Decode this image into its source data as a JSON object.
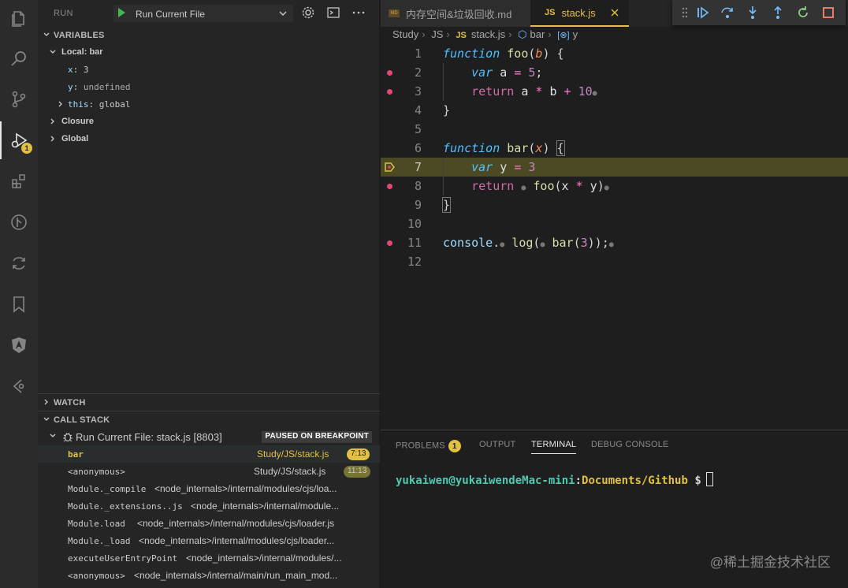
{
  "activity_bar": {
    "items": [
      "explorer-icon",
      "search-icon",
      "source-control-icon",
      "run-debug-icon",
      "extensions-icon",
      "git-graph-icon",
      "remote-sync-icon",
      "bookmarks-icon",
      "angular-icon",
      "gitlens-icon"
    ],
    "debug_badge": "1"
  },
  "run": {
    "label": "RUN",
    "config": "Run Current File"
  },
  "variables": {
    "header": "VARIABLES",
    "local_label": "Local: bar",
    "items": [
      {
        "name": "x",
        "value": "3"
      },
      {
        "name": "y",
        "value": "undefined"
      },
      {
        "name": "this",
        "value": "global"
      }
    ],
    "closure": "Closure",
    "global": "Global"
  },
  "watch": {
    "header": "WATCH"
  },
  "call_stack": {
    "header": "CALL STACK",
    "session": "Run Current File: stack.js [8803]",
    "status": "PAUSED ON BREAKPOINT",
    "frames": [
      {
        "fn": "bar",
        "path": "Study/JS/stack.js",
        "pos": "7:13"
      },
      {
        "fn": "<anonymous>",
        "path": "Study/JS/stack.js",
        "pos": "11:13"
      },
      {
        "fn": "Module._compile",
        "path": "<node_internals>/internal/modules/cjs/loa..."
      },
      {
        "fn": "Module._extensions..js",
        "path": "<node_internals>/internal/module..."
      },
      {
        "fn": "Module.load",
        "path": "<node_internals>/internal/modules/cjs/loader.js"
      },
      {
        "fn": "Module._load",
        "path": "<node_internals>/internal/modules/cjs/loader..."
      },
      {
        "fn": "executeUserEntryPoint",
        "path": "<node_internals>/internal/modules/..."
      },
      {
        "fn": "<anonymous>",
        "path": "<node_internals>/internal/main/run_main_mod..."
      }
    ]
  },
  "tabs": [
    {
      "label": "内存空间&垃圾回收.md",
      "active": false
    },
    {
      "label": "stack.js",
      "active": true
    }
  ],
  "breadcrumb": [
    "Study",
    "JS",
    "stack.js",
    "bar",
    "y"
  ],
  "breadcrumb_js": "JS",
  "code": {
    "line_numbers": [
      "1",
      "2",
      "3",
      "4",
      "5",
      "6",
      "7",
      "8",
      "9",
      "10",
      "11",
      "12"
    ],
    "current_line": "7"
  },
  "panel": {
    "tabs": [
      "PROBLEMS",
      "OUTPUT",
      "TERMINAL",
      "DEBUG CONSOLE"
    ],
    "problems_count": "1",
    "active_tab": "TERMINAL",
    "terminal_user": "yukaiwen@yukaiwendeMac-mini",
    "terminal_path": "Documents/Github",
    "terminal_prompt": "$"
  },
  "watermark": "@稀土掘金技术社区"
}
